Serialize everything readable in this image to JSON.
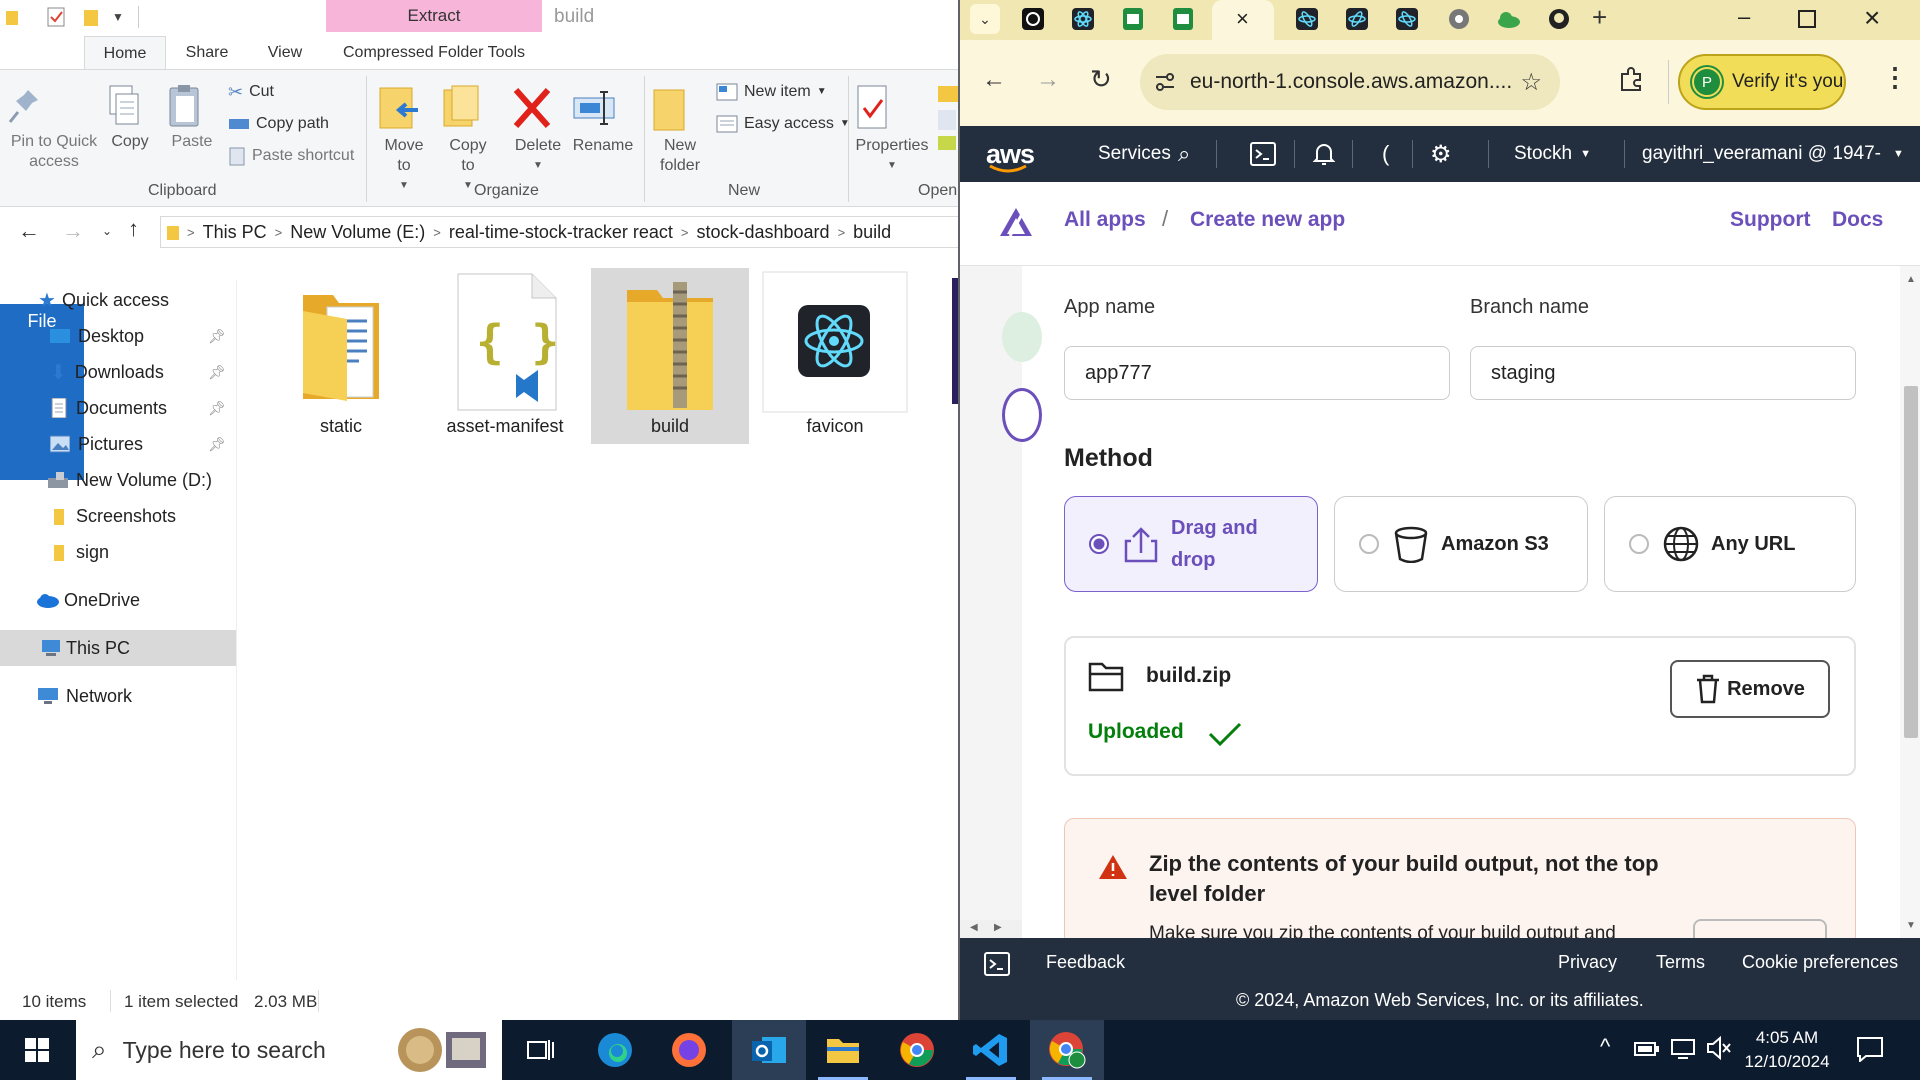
{
  "explorer": {
    "contextual_tab": "Extract",
    "window_title": "build",
    "tabs": {
      "file": "File",
      "home": "Home",
      "share": "Share",
      "view": "View",
      "tools": "Compressed Folder Tools"
    },
    "ribbon": {
      "pin": "Pin to Quick access",
      "copy": "Copy",
      "paste": "Paste",
      "cut": "Cut",
      "copy_path": "Copy path",
      "paste_shortcut": "Paste shortcut",
      "clipboard": "Clipboard",
      "move_to": "Move to",
      "copy_to": "Copy to",
      "delete": "Delete",
      "rename": "Rename",
      "organize": "Organize",
      "new_folder": "New folder",
      "new_item": "New item",
      "easy_access": "Easy access",
      "new": "New",
      "properties": "Properties",
      "open": "Open"
    },
    "address": {
      "crumbs": [
        "This PC",
        "New Volume (E:)",
        "real-time-stock-tracker react",
        "stock-dashboard",
        "build"
      ]
    },
    "nav": {
      "quick_access": "Quick access",
      "desktop": "Desktop",
      "downloads": "Downloads",
      "documents": "Documents",
      "pictures": "Pictures",
      "new_volume_d": "New Volume (D:)",
      "screenshots": "Screenshots",
      "sign": "sign",
      "onedrive": "OneDrive",
      "this_pc": "This PC",
      "network": "Network"
    },
    "files": {
      "static": "static",
      "asset_manifest": "asset-manifest",
      "build": "build",
      "favicon": "favicon"
    },
    "status": {
      "items": "10 items",
      "selected": "1 item selected",
      "size": "2.03 MB"
    }
  },
  "chrome": {
    "url": "eu-north-1.console.aws.amazon....",
    "verify": "Verify it's you",
    "profile_initial": "P"
  },
  "aws": {
    "logo": "aws",
    "services": "Services",
    "bracket": "(",
    "region": "Stockh",
    "account": "gayithri_veeramani @ 1947-"
  },
  "amplify": {
    "all_apps": "All apps",
    "slash": "/",
    "create_new_app": "Create new app",
    "support": "Support",
    "docs": "Docs",
    "app_name_label": "App name",
    "app_name_value": "app777",
    "branch_label": "Branch name",
    "branch_value": "staging",
    "method_title": "Method",
    "methods": {
      "drag": "Drag and drop",
      "s3": "Amazon S3",
      "url": "Any URL"
    },
    "file_name": "build.zip",
    "uploaded": "Uploaded",
    "remove": "Remove",
    "warning_title": "Zip the contents of your build output, not the top level folder",
    "warning_body": "Make sure you zip the contents of your build output and"
  },
  "footer": {
    "feedback": "Feedback",
    "privacy": "Privacy",
    "terms": "Terms",
    "cookies": "Cookie preferences",
    "copyright": "© 2024, Amazon Web Services, Inc. or its affiliates."
  },
  "taskbar": {
    "search_placeholder": "Type here to search",
    "time": "4:05 AM",
    "date": "12/10/2024"
  },
  "colors": {
    "aws_dark": "#232f3e",
    "amplify_purple": "#6b4fbb",
    "chrome_yellow": "#f1e7b2",
    "success_green": "#037f0c",
    "warning_red": "#d13212",
    "windows_blue": "#1f6cc5"
  }
}
